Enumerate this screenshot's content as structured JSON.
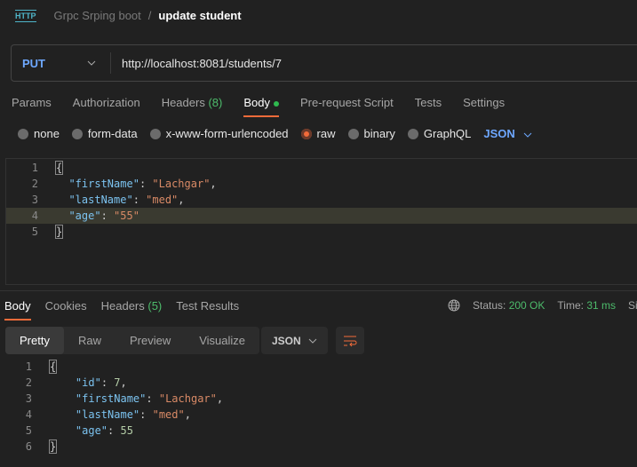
{
  "breadcrumb": {
    "icon": "http-icon",
    "icon_text": "HTTP",
    "collection": "Grpc Srping boot",
    "separator": "/",
    "request": "update student"
  },
  "request": {
    "method": "PUT",
    "url": "http://localhost:8081/students/7"
  },
  "request_tabs": [
    {
      "label": "Params"
    },
    {
      "label": "Authorization"
    },
    {
      "label": "Headers",
      "count": "(8)"
    },
    {
      "label": "Body",
      "active": true
    },
    {
      "label": "Pre-request Script"
    },
    {
      "label": "Tests"
    },
    {
      "label": "Settings"
    }
  ],
  "body_types": [
    {
      "label": "none"
    },
    {
      "label": "form-data"
    },
    {
      "label": "x-www-form-urlencoded"
    },
    {
      "label": "raw",
      "selected": true
    },
    {
      "label": "binary"
    },
    {
      "label": "GraphQL"
    }
  ],
  "body_format": "JSON",
  "request_body": [
    [
      [
        "1"
      ],
      [
        [
          "{",
          "br"
        ]
      ]
    ],
    [
      [
        "2"
      ],
      [
        [
          "  ",
          "p"
        ],
        [
          "\"firstName\"",
          "k"
        ],
        [
          ": ",
          "p"
        ],
        [
          "\"Lachgar\"",
          "s"
        ],
        [
          ",",
          "p"
        ]
      ]
    ],
    [
      [
        "3"
      ],
      [
        [
          "  ",
          "p"
        ],
        [
          "\"lastName\"",
          "k"
        ],
        [
          ": ",
          "p"
        ],
        [
          "\"med\"",
          "s"
        ],
        [
          ",",
          "p"
        ]
      ]
    ],
    [
      [
        "4"
      ],
      [
        [
          "  ",
          "p"
        ],
        [
          "\"age\"",
          "k"
        ],
        [
          ": ",
          "p"
        ],
        [
          "\"55\"",
          "s"
        ]
      ]
    ],
    [
      [
        "5"
      ],
      [
        [
          "}",
          "br"
        ]
      ]
    ]
  ],
  "response_tabs": [
    {
      "label": "Body",
      "active": true
    },
    {
      "label": "Cookies"
    },
    {
      "label": "Headers",
      "count": "(5)"
    },
    {
      "label": "Test Results"
    }
  ],
  "response_status": {
    "status_label": "Status:",
    "status": "200 OK",
    "time_label": "Time:",
    "time": "31 ms",
    "size_label": "Size"
  },
  "view_modes": [
    {
      "label": "Pretty",
      "active": true
    },
    {
      "label": "Raw"
    },
    {
      "label": "Preview"
    },
    {
      "label": "Visualize"
    }
  ],
  "response_format": "JSON",
  "response_body": [
    [
      [
        "1"
      ],
      [
        [
          "{",
          "br"
        ]
      ]
    ],
    [
      [
        "2"
      ],
      [
        [
          "    ",
          "p"
        ],
        [
          "\"id\"",
          "k"
        ],
        [
          ": ",
          "p"
        ],
        [
          "7",
          "n"
        ],
        [
          ",",
          "p"
        ]
      ]
    ],
    [
      [
        "3"
      ],
      [
        [
          "    ",
          "p"
        ],
        [
          "\"firstName\"",
          "k"
        ],
        [
          ": ",
          "p"
        ],
        [
          "\"Lachgar\"",
          "s"
        ],
        [
          ",",
          "p"
        ]
      ]
    ],
    [
      [
        "4"
      ],
      [
        [
          "    ",
          "p"
        ],
        [
          "\"lastName\"",
          "k"
        ],
        [
          ": ",
          "p"
        ],
        [
          "\"med\"",
          "s"
        ],
        [
          ",",
          "p"
        ]
      ]
    ],
    [
      [
        "5"
      ],
      [
        [
          "    ",
          "p"
        ],
        [
          "\"age\"",
          "k"
        ],
        [
          ": ",
          "p"
        ],
        [
          "55",
          "n"
        ]
      ]
    ],
    [
      [
        "6"
      ],
      [
        [
          "}",
          "br"
        ]
      ]
    ]
  ],
  "colors": {
    "accent": "#f26b3a",
    "method": "#6ea8ff",
    "success": "#4dbb6b",
    "background": "#212121"
  }
}
